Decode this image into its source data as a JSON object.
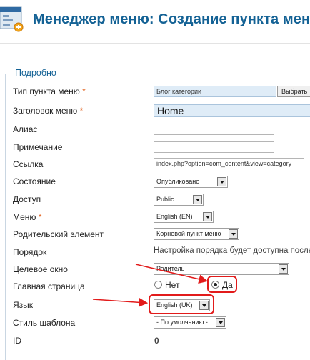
{
  "header": {
    "title": "Менеджер меню: Создание пункта меню",
    "icon": "menu-manager-icon"
  },
  "section": {
    "legend": "Подробно"
  },
  "fields": {
    "type": {
      "label": "Тип пункта меню",
      "value": "Блог категории",
      "button": "Выбрать"
    },
    "title": {
      "label": "Заголовок меню",
      "value": "Home"
    },
    "alias": {
      "label": "Алиас",
      "value": ""
    },
    "note": {
      "label": "Примечание",
      "value": ""
    },
    "link": {
      "label": "Ссылка",
      "value": "index.php?option=com_content&view=category"
    },
    "state": {
      "label": "Состояние",
      "value": "Опубликовано"
    },
    "access": {
      "label": "Доступ",
      "value": "Public"
    },
    "menu": {
      "label": "Меню",
      "value": "English (EN)"
    },
    "parent": {
      "label": "Родительский элемент",
      "value": "Корневой пункт меню"
    },
    "order": {
      "label": "Порядок",
      "value": "Настройка порядка будет доступна после"
    },
    "target": {
      "label": "Целевое окно",
      "value": "Родитель"
    },
    "home": {
      "label": "Главная страница",
      "opt_no": "Нет",
      "opt_yes": "Да",
      "selected": "Да"
    },
    "language": {
      "label": "Язык",
      "value": "English (UK)"
    },
    "template": {
      "label": "Стиль шаблона",
      "value": "- По умолчанию -"
    },
    "id": {
      "label": "ID",
      "value": "0"
    }
  },
  "required_mark": "*",
  "colors": {
    "title": "#146295",
    "annotation": "#e21b1b",
    "required": "#e05a12"
  }
}
